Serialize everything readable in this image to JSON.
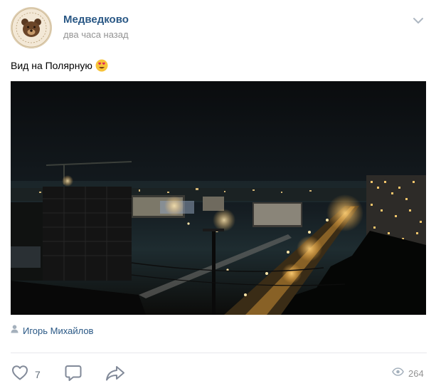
{
  "post": {
    "author": "Медведково",
    "time": "два часа назад",
    "text": "Вид на Полярную",
    "emoji": "heart-eyes-emoji",
    "signature": "Игорь Михайлов"
  },
  "actions": {
    "likes": "7",
    "views": "264"
  },
  "colors": {
    "link": "#2a5885",
    "secondary": "#939393",
    "icon": "#828a99",
    "divider": "#e7e8ec"
  }
}
